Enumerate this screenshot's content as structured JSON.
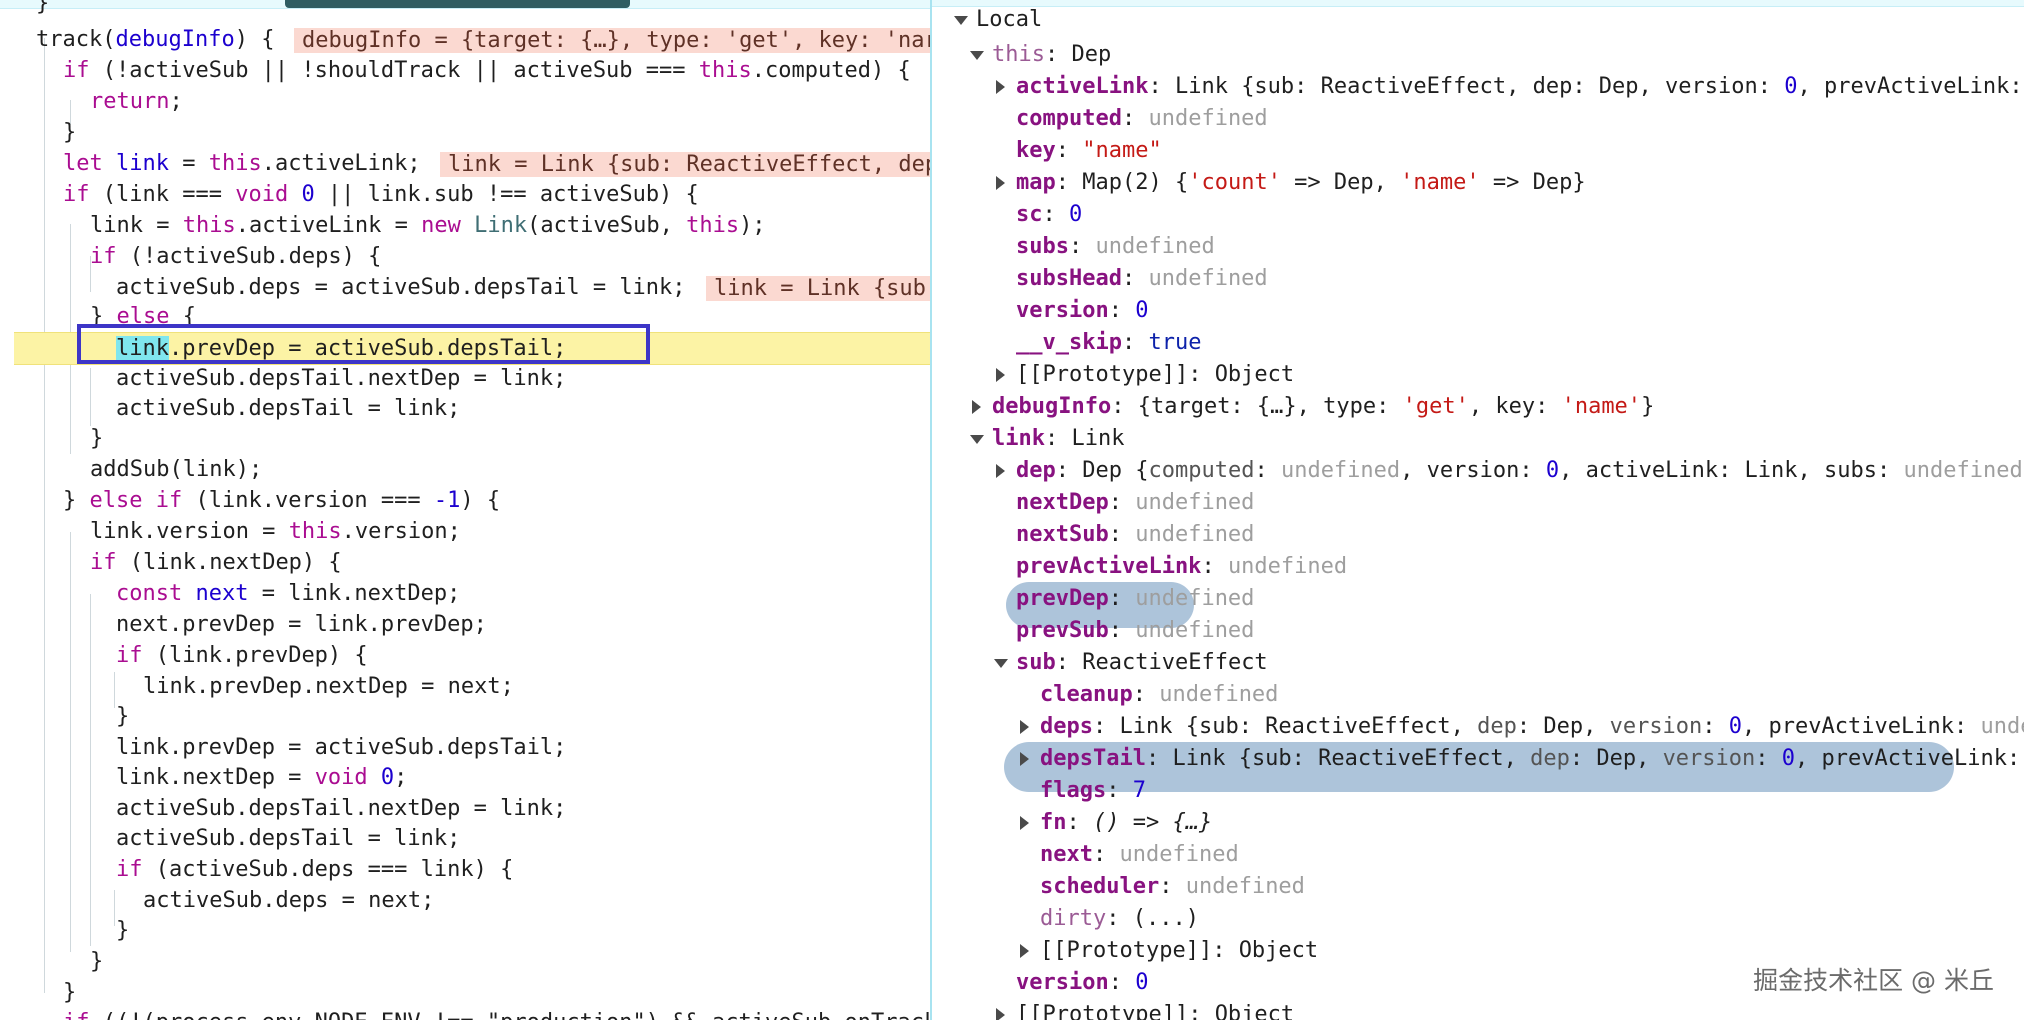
{
  "source": {
    "inline_values": {
      "debugInfo": "debugInfo = {target: {…}, type: 'get', key: 'nar",
      "link_let": "link = Link {sub: ReactiveEffect, dep",
      "link_deps": "link = Link {sub"
    },
    "lines": {
      "l0": "}",
      "l1_a": "track(",
      "l1_b": "debugInfo",
      "l1_c": ") {",
      "l2_a": "if",
      "l2_b": " (!activeSub || !shouldTrack || activeSub === ",
      "l2_c": "this",
      "l2_d": ".computed) {",
      "l3": "return",
      "l3_b": ";",
      "l4": "}",
      "l5_a": "let",
      "l5_b": "link",
      "l5_c": " = ",
      "l5_d": "this",
      "l5_e": ".activeLink;",
      "l6_a": "if",
      "l6_b": " (link === ",
      "l6_c": "void",
      "l6_d": " ",
      "l6_e": "0",
      "l6_f": " || link.sub !== activeSub) {",
      "l7_a": "link = ",
      "l7_b": "this",
      "l7_c": ".activeLink = ",
      "l7_d": "new",
      "l7_e": " ",
      "l7_f": "Link",
      "l7_g": "(activeSub, ",
      "l7_h": "this",
      "l7_i": ");",
      "l8_a": "if",
      "l8_b": " (!activeSub.deps) {",
      "l9": "activeSub.deps = activeSub.depsTail = link;",
      "l10_a": "} ",
      "l10_b": "else",
      "l10_c": " {",
      "l11_a": "link",
      "l11_b": ".prevDep = activeSub.depsTail;",
      "l12": "activeSub.depsTail.nextDep = link;",
      "l13": "activeSub.depsTail = link;",
      "l14": "}",
      "l15": "addSub(link);",
      "l16_a": "} ",
      "l16_b": "else",
      "l16_c": " ",
      "l16_d": "if",
      "l16_e": " (link.version === ",
      "l16_f": "-1",
      "l16_g": ") {",
      "l17_a": "link.version = ",
      "l17_b": "this",
      "l17_c": ".version;",
      "l18_a": "if",
      "l18_b": " (link.nextDep) {",
      "l19_a": "const",
      "l19_b": " ",
      "l19_c": "next",
      "l19_d": " = link.nextDep;",
      "l20": "next.prevDep = link.prevDep;",
      "l21_a": "if",
      "l21_b": " (link.prevDep) {",
      "l22": "link.prevDep.nextDep = next;",
      "l23": "}",
      "l24": "link.prevDep = activeSub.depsTail;",
      "l25_a": "link.nextDep = ",
      "l25_b": "void",
      "l25_c": " ",
      "l25_d": "0",
      "l25_e": ";",
      "l26": "activeSub.depsTail.nextDep = link;",
      "l27": "activeSub.depsTail = link;",
      "l28_a": "if",
      "l28_b": " (activeSub.deps === link) {",
      "l29": "activeSub.deps = next;",
      "l30": "}",
      "l31": "}",
      "l32": "}",
      "l33_a": "if",
      "l33_b": " ((!(process.env.NODE_ENV !== \"production\") && activeSub.onTrack"
    }
  },
  "scope": {
    "local": "Local",
    "this_name": "this",
    "this_type": "Dep",
    "activeLink": {
      "name": "activeLink",
      "value_type": "Link",
      "value_rest": "{sub: ReactiveEffect, dep: Dep, version: ",
      "value_num": "0",
      "value_tail": ", prevActiveLink: "
    },
    "computed": {
      "name": "computed",
      "value": "undefined"
    },
    "key": {
      "name": "key",
      "value": "\"name\""
    },
    "map": {
      "name": "map",
      "value_a": "Map(2) {",
      "k1": "'count'",
      "value_b": " => Dep, ",
      "k2": "'name'",
      "value_c": " => Dep}"
    },
    "sc": {
      "name": "sc",
      "value": "0"
    },
    "subs": {
      "name": "subs",
      "value": "undefined"
    },
    "subsHead": {
      "name": "subsHead",
      "value": "undefined"
    },
    "version": {
      "name": "version",
      "value": "0"
    },
    "v_skip": {
      "name": "__v_skip",
      "value": "true"
    },
    "prototype1": {
      "name": "[[Prototype]]",
      "value": "Object"
    },
    "debugInfo": {
      "name": "debugInfo",
      "v_a": "{target: {…}, type: ",
      "v_b": "'get'",
      "v_c": ", key: ",
      "v_d": "'name'",
      "v_e": "}"
    },
    "link_name": "link",
    "link_type": "Link",
    "dep": {
      "name": "dep",
      "v_a": "Dep {",
      "v_b": "computed",
      "v_c": ": ",
      "v_d": "undefined",
      "v_e": ", version: ",
      "v_f": "0",
      "v_g": ", activeLink: Link, subs: ",
      "v_h": "undefined"
    },
    "nextDep": {
      "name": "nextDep",
      "value": "undefined"
    },
    "nextSub": {
      "name": "nextSub",
      "value": "undefined"
    },
    "prevActiveLink": {
      "name": "prevActiveLink",
      "value": "undefined"
    },
    "prevDep": {
      "name": "prevDep",
      "value": "undefined"
    },
    "prevSub": {
      "name": "prevSub",
      "value": "undefined"
    },
    "sub": {
      "name": "sub",
      "value": "ReactiveEffect"
    },
    "cleanup": {
      "name": "cleanup",
      "value": "undefined"
    },
    "deps": {
      "name": "deps",
      "v_a": "Link {sub: ReactiveEffect, ",
      "v_b": "dep",
      "v_c": ": Dep, ",
      "v_d": "version",
      "v_e": ": ",
      "v_f": "0",
      "v_g": ", prevActiveLink: ",
      "v_h": "unde"
    },
    "depsTail": {
      "name": "depsTail",
      "v_a": "Link {sub: ReactiveEffect, ",
      "v_b": "dep",
      "v_c": ": Dep, ",
      "v_d": "version",
      "v_e": ": ",
      "v_f": "0",
      "v_g": ", prevActiveLink: "
    },
    "flags": {
      "name": "flags",
      "value": "7"
    },
    "fn": {
      "name": "fn",
      "value": "() => {…}"
    },
    "next": {
      "name": "next",
      "value": "undefined"
    },
    "scheduler": {
      "name": "scheduler",
      "value": "undefined"
    },
    "dirty": {
      "name": "dirty",
      "value": "(...)"
    },
    "prototype2": {
      "name": "[[Prototype]]",
      "value": "Object"
    },
    "version2": {
      "name": "version",
      "value": "0"
    },
    "prototype3": {
      "name": "[[Prototype]]",
      "value": "Object"
    }
  },
  "watermark": "掘金技术社区 @ 米丘",
  "colors": {
    "current_line": "#fcf3a5",
    "highlight_box": "#3d35c7",
    "annotation": "#6a93bc",
    "inline_value": "#fbd9d1"
  }
}
